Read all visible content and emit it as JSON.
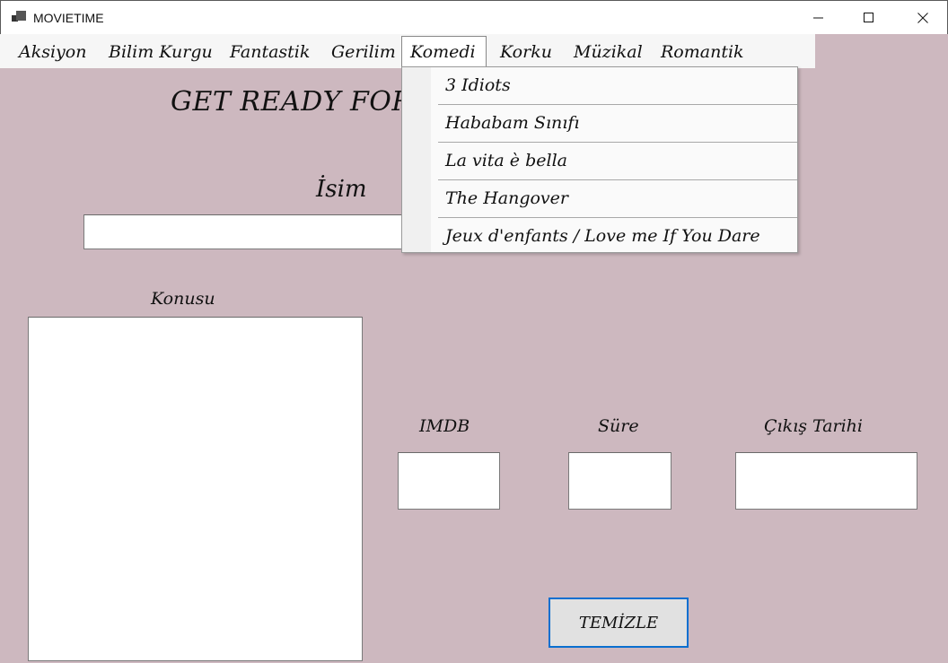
{
  "window": {
    "title": "MOVIETIME",
    "icon": "app-icon"
  },
  "menu": {
    "items": [
      {
        "label": "Aksiyon"
      },
      {
        "label": "Bilim Kurgu"
      },
      {
        "label": "Fantastik"
      },
      {
        "label": "Gerilim"
      },
      {
        "label": "Komedi"
      },
      {
        "label": "Korku"
      },
      {
        "label": "Müzikal"
      },
      {
        "label": "Romantik"
      }
    ],
    "open_menu": "Komedi",
    "dropdown_items": [
      {
        "label": "3 Idiots"
      },
      {
        "label": "Hababam Sınıfı"
      },
      {
        "label": "La vita è bella"
      },
      {
        "label": "The Hangover"
      },
      {
        "label": "Jeux d'enfants / Love me If You Dare"
      }
    ]
  },
  "main": {
    "heading": "GET READY FOR",
    "name_label": "İsim",
    "name_value": "",
    "plot_label": "Konusu",
    "plot_value": "",
    "imdb_label": "IMDB",
    "imdb_value": "",
    "duration_label": "Süre",
    "duration_value": "",
    "release_label": "Çıkış Tarihi",
    "release_value": "",
    "clear_button": "TEMİZLE"
  },
  "colors": {
    "background": "#cdb8bf",
    "button_border": "#0a6fd0"
  }
}
